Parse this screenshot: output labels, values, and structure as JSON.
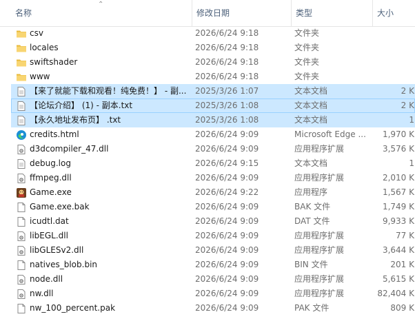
{
  "columns": {
    "name": "名称",
    "date": "修改日期",
    "type": "类型",
    "size": "大小"
  },
  "files": [
    {
      "name": "csv",
      "date": "2026/6/24 9:18",
      "type": "文件夹",
      "size": "",
      "icon": "folder-icon",
      "state": ""
    },
    {
      "name": "locales",
      "date": "2026/6/24 9:18",
      "type": "文件夹",
      "size": "",
      "icon": "folder-icon",
      "state": ""
    },
    {
      "name": "swiftshader",
      "date": "2026/6/24 9:18",
      "type": "文件夹",
      "size": "",
      "icon": "folder-icon",
      "state": ""
    },
    {
      "name": "www",
      "date": "2026/6/24 9:18",
      "type": "文件夹",
      "size": "",
      "icon": "folder-icon",
      "state": ""
    },
    {
      "name": "【来了就能下载和观看！纯免费！】 - 副...",
      "date": "2025/3/26 1:07",
      "type": "文本文档",
      "size": "2 K",
      "icon": "text-file-icon",
      "state": "selected"
    },
    {
      "name": "【论坛介绍】 (1) - 副本.txt",
      "date": "2025/3/26 1:08",
      "type": "文本文档",
      "size": "2 K",
      "icon": "text-file-icon",
      "state": "focused"
    },
    {
      "name": "【永久地址发布页】 .txt",
      "date": "2025/3/26 1:08",
      "type": "文本文档",
      "size": "1",
      "icon": "text-file-icon",
      "state": "selected"
    },
    {
      "name": "credits.html",
      "date": "2026/6/24 9:09",
      "type": "Microsoft Edge ...",
      "size": "1,970 K",
      "icon": "edge-icon",
      "state": ""
    },
    {
      "name": "d3dcompiler_47.dll",
      "date": "2026/6/24 9:09",
      "type": "应用程序扩展",
      "size": "3,576 K",
      "icon": "dll-file-icon",
      "state": ""
    },
    {
      "name": "debug.log",
      "date": "2026/6/24 9:15",
      "type": "文本文档",
      "size": "1",
      "icon": "text-file-icon",
      "state": ""
    },
    {
      "name": "ffmpeg.dll",
      "date": "2026/6/24 9:09",
      "type": "应用程序扩展",
      "size": "2,010 K",
      "icon": "dll-file-icon",
      "state": ""
    },
    {
      "name": "Game.exe",
      "date": "2026/6/24 9:22",
      "type": "应用程序",
      "size": "1,567 K",
      "icon": "game-exe-icon",
      "state": ""
    },
    {
      "name": "Game.exe.bak",
      "date": "2026/6/24 9:09",
      "type": "BAK 文件",
      "size": "1,749 K",
      "icon": "blank-file-icon",
      "state": ""
    },
    {
      "name": "icudtl.dat",
      "date": "2026/6/24 9:09",
      "type": "DAT 文件",
      "size": "9,933 K",
      "icon": "blank-file-icon",
      "state": ""
    },
    {
      "name": "libEGL.dll",
      "date": "2026/6/24 9:09",
      "type": "应用程序扩展",
      "size": "77 K",
      "icon": "dll-file-icon",
      "state": ""
    },
    {
      "name": "libGLESv2.dll",
      "date": "2026/6/24 9:09",
      "type": "应用程序扩展",
      "size": "3,644 K",
      "icon": "dll-file-icon",
      "state": ""
    },
    {
      "name": "natives_blob.bin",
      "date": "2026/6/24 9:09",
      "type": "BIN 文件",
      "size": "201 K",
      "icon": "blank-file-icon",
      "state": ""
    },
    {
      "name": "node.dll",
      "date": "2026/6/24 9:09",
      "type": "应用程序扩展",
      "size": "5,615 K",
      "icon": "dll-file-icon",
      "state": ""
    },
    {
      "name": "nw.dll",
      "date": "2026/6/24 9:09",
      "type": "应用程序扩展",
      "size": "82,404 K",
      "icon": "dll-file-icon",
      "state": ""
    },
    {
      "name": "nw_100_percent.pak",
      "date": "2026/6/24 9:09",
      "type": "PAK 文件",
      "size": "809 K",
      "icon": "blank-file-icon",
      "state": ""
    }
  ]
}
